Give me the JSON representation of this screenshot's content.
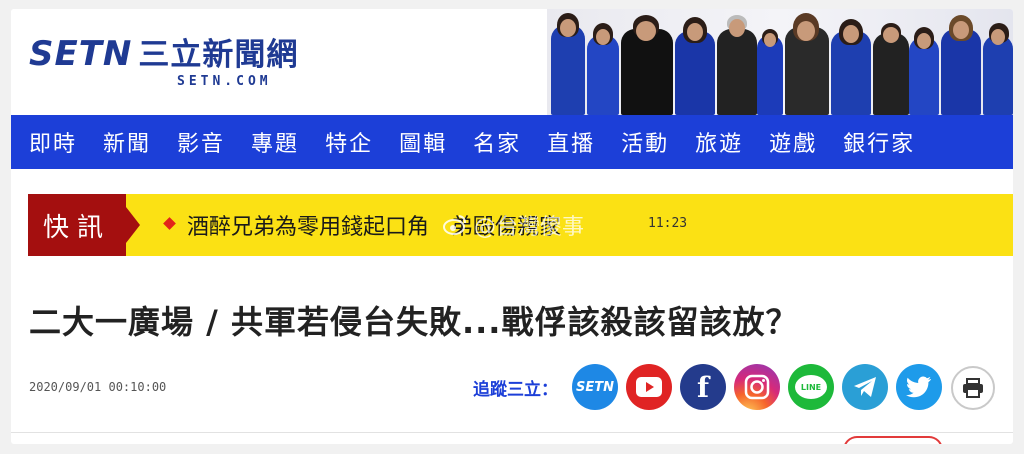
{
  "site": {
    "logo_setn": "SETN",
    "logo_cn": "三立新聞網",
    "logo_sub": "SETN.COM"
  },
  "nav": {
    "items": [
      "即時",
      "新聞",
      "影音",
      "專題",
      "特企",
      "圖輯",
      "名家",
      "直播",
      "活動",
      "旅遊",
      "遊戲",
      "銀行家"
    ]
  },
  "breaking": {
    "label": "快訊",
    "text": "酒醉兄弟為零用錢起口角　弟毆傷親家",
    "time": "11:23"
  },
  "watermark": {
    "text": "@台灣傻事"
  },
  "article": {
    "headline": "二大一廣場 / 共軍若侵台失敗...戰俘該殺該留該放？",
    "date": "2020/09/01 00:10:00"
  },
  "follow": {
    "label": "追蹤三立：",
    "setn_label": "SETN",
    "youtube_label": "▶",
    "facebook_label": "f",
    "line_label": "LINE"
  },
  "colors": {
    "brand_blue": "#1c3fd8",
    "logo_blue": "#1f3a93",
    "breaking_yellow": "#fbe114",
    "breaking_red": "#a40f0f"
  },
  "icons": [
    "setn-icon",
    "youtube-icon",
    "facebook-icon",
    "instagram-icon",
    "line-icon",
    "telegram-icon",
    "twitter-icon",
    "print-icon"
  ]
}
